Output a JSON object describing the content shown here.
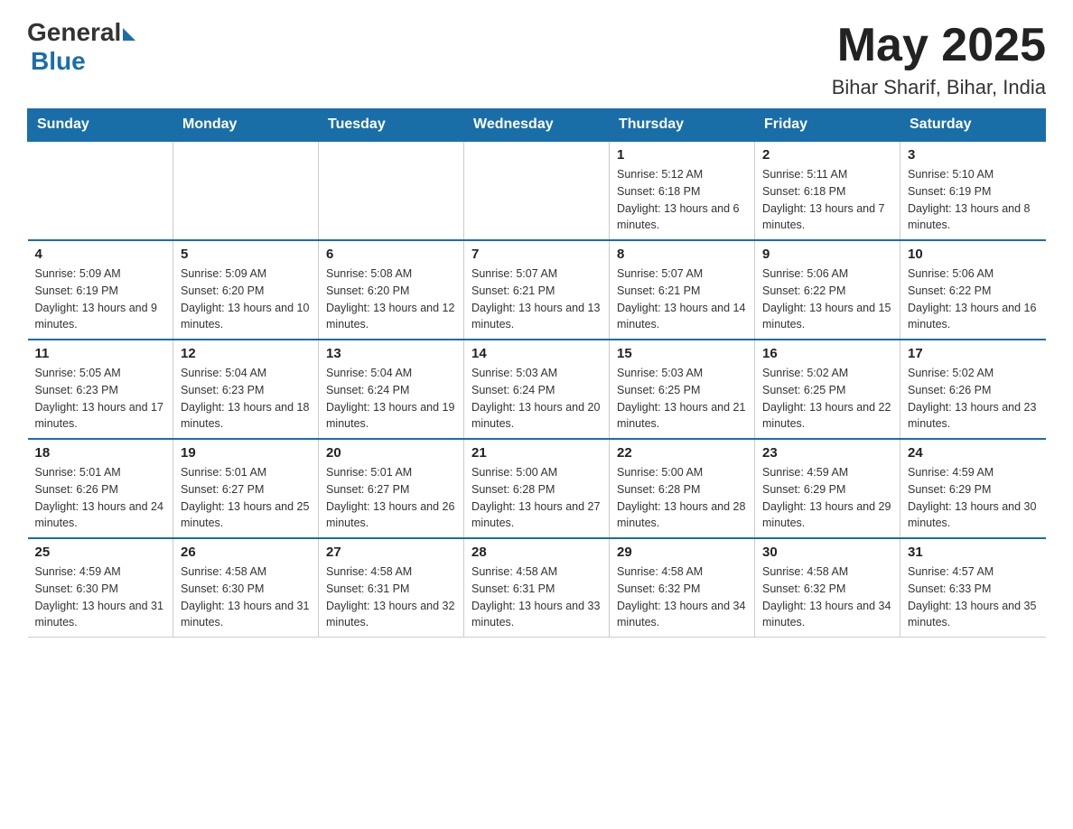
{
  "logo": {
    "general": "General",
    "blue": "Blue"
  },
  "title": "May 2025",
  "subtitle": "Bihar Sharif, Bihar, India",
  "days_of_week": [
    "Sunday",
    "Monday",
    "Tuesday",
    "Wednesday",
    "Thursday",
    "Friday",
    "Saturday"
  ],
  "weeks": [
    [
      {
        "day": "",
        "info": ""
      },
      {
        "day": "",
        "info": ""
      },
      {
        "day": "",
        "info": ""
      },
      {
        "day": "",
        "info": ""
      },
      {
        "day": "1",
        "info": "Sunrise: 5:12 AM\nSunset: 6:18 PM\nDaylight: 13 hours and 6 minutes."
      },
      {
        "day": "2",
        "info": "Sunrise: 5:11 AM\nSunset: 6:18 PM\nDaylight: 13 hours and 7 minutes."
      },
      {
        "day": "3",
        "info": "Sunrise: 5:10 AM\nSunset: 6:19 PM\nDaylight: 13 hours and 8 minutes."
      }
    ],
    [
      {
        "day": "4",
        "info": "Sunrise: 5:09 AM\nSunset: 6:19 PM\nDaylight: 13 hours and 9 minutes."
      },
      {
        "day": "5",
        "info": "Sunrise: 5:09 AM\nSunset: 6:20 PM\nDaylight: 13 hours and 10 minutes."
      },
      {
        "day": "6",
        "info": "Sunrise: 5:08 AM\nSunset: 6:20 PM\nDaylight: 13 hours and 12 minutes."
      },
      {
        "day": "7",
        "info": "Sunrise: 5:07 AM\nSunset: 6:21 PM\nDaylight: 13 hours and 13 minutes."
      },
      {
        "day": "8",
        "info": "Sunrise: 5:07 AM\nSunset: 6:21 PM\nDaylight: 13 hours and 14 minutes."
      },
      {
        "day": "9",
        "info": "Sunrise: 5:06 AM\nSunset: 6:22 PM\nDaylight: 13 hours and 15 minutes."
      },
      {
        "day": "10",
        "info": "Sunrise: 5:06 AM\nSunset: 6:22 PM\nDaylight: 13 hours and 16 minutes."
      }
    ],
    [
      {
        "day": "11",
        "info": "Sunrise: 5:05 AM\nSunset: 6:23 PM\nDaylight: 13 hours and 17 minutes."
      },
      {
        "day": "12",
        "info": "Sunrise: 5:04 AM\nSunset: 6:23 PM\nDaylight: 13 hours and 18 minutes."
      },
      {
        "day": "13",
        "info": "Sunrise: 5:04 AM\nSunset: 6:24 PM\nDaylight: 13 hours and 19 minutes."
      },
      {
        "day": "14",
        "info": "Sunrise: 5:03 AM\nSunset: 6:24 PM\nDaylight: 13 hours and 20 minutes."
      },
      {
        "day": "15",
        "info": "Sunrise: 5:03 AM\nSunset: 6:25 PM\nDaylight: 13 hours and 21 minutes."
      },
      {
        "day": "16",
        "info": "Sunrise: 5:02 AM\nSunset: 6:25 PM\nDaylight: 13 hours and 22 minutes."
      },
      {
        "day": "17",
        "info": "Sunrise: 5:02 AM\nSunset: 6:26 PM\nDaylight: 13 hours and 23 minutes."
      }
    ],
    [
      {
        "day": "18",
        "info": "Sunrise: 5:01 AM\nSunset: 6:26 PM\nDaylight: 13 hours and 24 minutes."
      },
      {
        "day": "19",
        "info": "Sunrise: 5:01 AM\nSunset: 6:27 PM\nDaylight: 13 hours and 25 minutes."
      },
      {
        "day": "20",
        "info": "Sunrise: 5:01 AM\nSunset: 6:27 PM\nDaylight: 13 hours and 26 minutes."
      },
      {
        "day": "21",
        "info": "Sunrise: 5:00 AM\nSunset: 6:28 PM\nDaylight: 13 hours and 27 minutes."
      },
      {
        "day": "22",
        "info": "Sunrise: 5:00 AM\nSunset: 6:28 PM\nDaylight: 13 hours and 28 minutes."
      },
      {
        "day": "23",
        "info": "Sunrise: 4:59 AM\nSunset: 6:29 PM\nDaylight: 13 hours and 29 minutes."
      },
      {
        "day": "24",
        "info": "Sunrise: 4:59 AM\nSunset: 6:29 PM\nDaylight: 13 hours and 30 minutes."
      }
    ],
    [
      {
        "day": "25",
        "info": "Sunrise: 4:59 AM\nSunset: 6:30 PM\nDaylight: 13 hours and 31 minutes."
      },
      {
        "day": "26",
        "info": "Sunrise: 4:58 AM\nSunset: 6:30 PM\nDaylight: 13 hours and 31 minutes."
      },
      {
        "day": "27",
        "info": "Sunrise: 4:58 AM\nSunset: 6:31 PM\nDaylight: 13 hours and 32 minutes."
      },
      {
        "day": "28",
        "info": "Sunrise: 4:58 AM\nSunset: 6:31 PM\nDaylight: 13 hours and 33 minutes."
      },
      {
        "day": "29",
        "info": "Sunrise: 4:58 AM\nSunset: 6:32 PM\nDaylight: 13 hours and 34 minutes."
      },
      {
        "day": "30",
        "info": "Sunrise: 4:58 AM\nSunset: 6:32 PM\nDaylight: 13 hours and 34 minutes."
      },
      {
        "day": "31",
        "info": "Sunrise: 4:57 AM\nSunset: 6:33 PM\nDaylight: 13 hours and 35 minutes."
      }
    ]
  ]
}
